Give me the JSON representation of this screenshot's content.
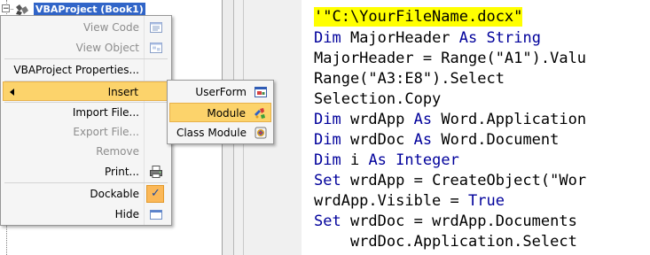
{
  "project_tree": {
    "project_label": "VBAProject (Book1)",
    "expander_symbol": "−",
    "project_icon": "vba-project-icon"
  },
  "context_menu": {
    "items": [
      {
        "label": "View Code",
        "disabled": true,
        "icon": "view-code-icon"
      },
      {
        "label": "View Object",
        "disabled": true,
        "icon": "view-object-icon"
      },
      {
        "label": "VBAProject Properties...",
        "disabled": false
      },
      {
        "label": "Insert",
        "disabled": false,
        "highlighted": true,
        "has_submenu": true
      },
      {
        "label": "Import File...",
        "disabled": false
      },
      {
        "label": "Export File...",
        "disabled": true
      },
      {
        "label": "Remove",
        "disabled": true
      },
      {
        "label": "Print...",
        "disabled": false,
        "icon": "printer-icon"
      },
      {
        "label": "Dockable",
        "disabled": false,
        "checked": true,
        "check_symbol": "✓"
      },
      {
        "label": "Hide",
        "disabled": false,
        "icon": "hide-window-icon"
      }
    ]
  },
  "insert_submenu": {
    "items": [
      {
        "label": "UserForm",
        "icon": "userform-icon"
      },
      {
        "label": "Module",
        "icon": "module-icon",
        "highlighted": true
      },
      {
        "label": "Class Module",
        "icon": "class-module-icon"
      }
    ]
  },
  "code_pane": {
    "lines": [
      {
        "text": "'\"C:\\YourFileName.docx\"",
        "highlight": "yellow"
      },
      {
        "kw": "Dim",
        "rest": " MajorHeader ",
        "kw2": "As",
        "rest2": " ",
        "kw3": "String",
        "rest3": ""
      },
      {
        "kw": "",
        "rest": "MajorHeader = Range(\"A1\").Valu",
        "kw2": "",
        "rest2": "",
        "kw3": "",
        "rest3": ""
      },
      {
        "kw": "",
        "rest": "Range(\"A3:E8\").Select",
        "kw2": "",
        "rest2": "",
        "kw3": "",
        "rest3": ""
      },
      {
        "kw": "",
        "rest": "Selection.Copy",
        "kw2": "",
        "rest2": "",
        "kw3": "",
        "rest3": ""
      },
      {
        "kw": "Dim",
        "rest": " wrdApp ",
        "kw2": "As",
        "rest2": " Word.Application",
        "kw3": "",
        "rest3": ""
      },
      {
        "kw": "Dim",
        "rest": " wrdDoc ",
        "kw2": "As",
        "rest2": " Word.Document",
        "kw3": "",
        "rest3": ""
      },
      {
        "kw": "Dim",
        "rest": " i ",
        "kw2": "As",
        "rest2": " ",
        "kw3": "Integer",
        "rest3": ""
      },
      {
        "kw": "Set",
        "rest": " wrdApp = CreateObject(\"Wor",
        "kw2": "",
        "rest2": "",
        "kw3": "",
        "rest3": ""
      },
      {
        "kw": "",
        "rest": "wrdApp.Visible = ",
        "kw2": "True",
        "rest2": "",
        "kw3": "",
        "rest3": ""
      },
      {
        "kw": "Set",
        "rest": " wrdDoc = wrdApp.Documents",
        "kw2": "",
        "rest2": "",
        "kw3": "",
        "rest3": ""
      },
      {
        "kw": "",
        "rest": "    wrdDoc.Application.Select",
        "kw2": "",
        "rest2": "",
        "kw3": "",
        "rest3": ""
      }
    ]
  },
  "colors": {
    "selection_blue": "#3165c8",
    "menu_highlight": "#fcd36b",
    "keyword_blue": "#00009b",
    "line_highlight": "#ffff00"
  }
}
